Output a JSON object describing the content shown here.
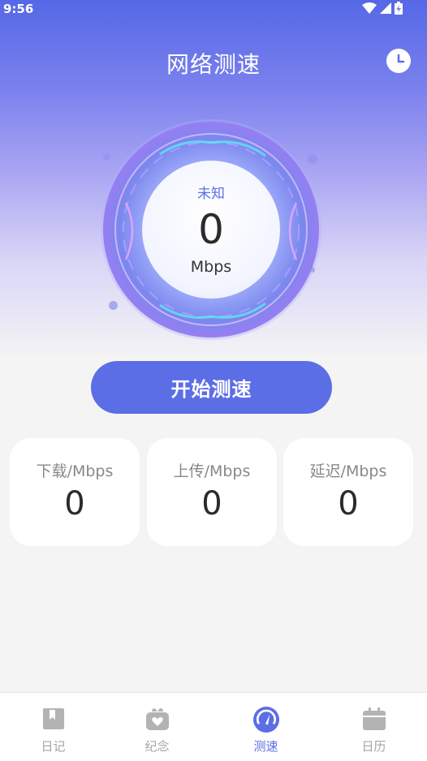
{
  "status_bar": {
    "time": "9:56"
  },
  "header": {
    "title": "网络测速"
  },
  "meter": {
    "status": "未知",
    "value": "0",
    "unit": "Mbps"
  },
  "start_button": {
    "label": "开始测速"
  },
  "stats": [
    {
      "label": "下载/Mbps",
      "value": "0"
    },
    {
      "label": "上传/Mbps",
      "value": "0"
    },
    {
      "label": "延迟/Mbps",
      "value": "0"
    }
  ],
  "tabs": [
    {
      "label": "日记",
      "icon": "bookmark-book-icon",
      "active": false
    },
    {
      "label": "纪念",
      "icon": "gift-heart-icon",
      "active": false
    },
    {
      "label": "测速",
      "icon": "speedometer-icon",
      "active": true
    },
    {
      "label": "日历",
      "icon": "calendar-icon",
      "active": false
    }
  ],
  "colors": {
    "accent": "#5b6ee6",
    "inactive": "#a5a5a5",
    "background": "#f4f4f5"
  }
}
